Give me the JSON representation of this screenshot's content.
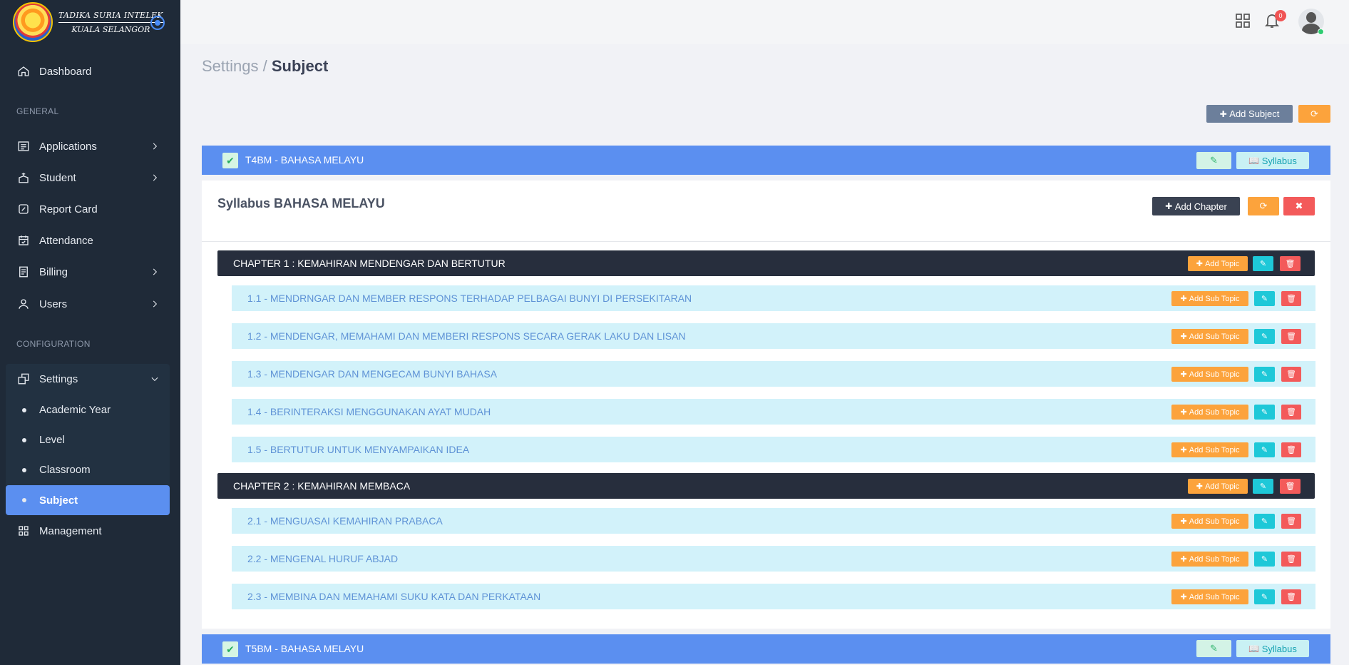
{
  "brand": {
    "line1": "TADIKA SURIA INTELEK",
    "line2": "KUALA SELANGOR"
  },
  "sidebar": {
    "dashboard": "Dashboard",
    "general_label": "GENERAL",
    "items": [
      "Applications",
      "Student",
      "Report Card",
      "Attendance",
      "Billing",
      "Users"
    ],
    "config_label": "CONFIGURATION",
    "settings": "Settings",
    "settings_sub": [
      "Academic Year",
      "Level",
      "Classroom",
      "Subject"
    ],
    "management": "Management"
  },
  "topbar": {
    "notification_count": "0"
  },
  "breadcrumb": {
    "parent": "Settings",
    "separator": " / ",
    "current": "Subject"
  },
  "toolbar": {
    "add_subject": "Add Subject"
  },
  "subjects": [
    {
      "title": "T4BM - BAHASA MELAYU",
      "syllabus_label": "Syllabus"
    },
    {
      "title": "T5BM - BAHASA MELAYU",
      "syllabus_label": "Syllabus"
    }
  ],
  "syllabus": {
    "title": "Syllabus BAHASA MELAYU",
    "add_chapter": "Add Chapter",
    "add_topic": "Add Topic",
    "add_sub_topic": "Add Sub Topic",
    "chapters": [
      {
        "title": "CHAPTER 1 : KEMAHIRAN MENDENGAR DAN BERTUTUR",
        "topics": [
          "1.1 - MENDRNGAR DAN MEMBER RESPONS TERHADAP PELBAGAI BUNYI DI PERSEKITARAN",
          "1.2 - MENDENGAR, MEMAHAMI DAN MEMBERI RESPONS SECARA GERAK LAKU DAN LISAN",
          "1.3 - MENDENGAR DAN MENGECAM BUNYI BAHASA",
          "1.4 - BERINTERAKSI MENGGUNAKAN AYAT MUDAH",
          "1.5 - BERTUTUR UNTUK MENYAMPAIKAN IDEA"
        ]
      },
      {
        "title": "CHAPTER 2 : KEMAHIRAN MEMBACA",
        "topics": [
          "2.1 - MENGUASAI KEMAHIRAN PRABACA",
          "2.2 - MENGENAL HURUF ABJAD",
          "2.3 - MEMBINA DAN MEMAHAMI SUKU KATA DAN PERKATAAN"
        ]
      }
    ]
  },
  "icons": {
    "plus": "✚",
    "refresh": "⟳",
    "close": "✖",
    "edit": "✎",
    "trash": "🗑",
    "book": "📖",
    "check": "✔"
  },
  "colors": {
    "sidebar_bg": "#1f2a38",
    "accent_blue": "#5b8ff0",
    "orange": "#fca33c",
    "red": "#f35a5a",
    "teal": "#1ec8d8",
    "chapter_bg": "#272e3d",
    "topic_bg": "#d2f2fa"
  }
}
